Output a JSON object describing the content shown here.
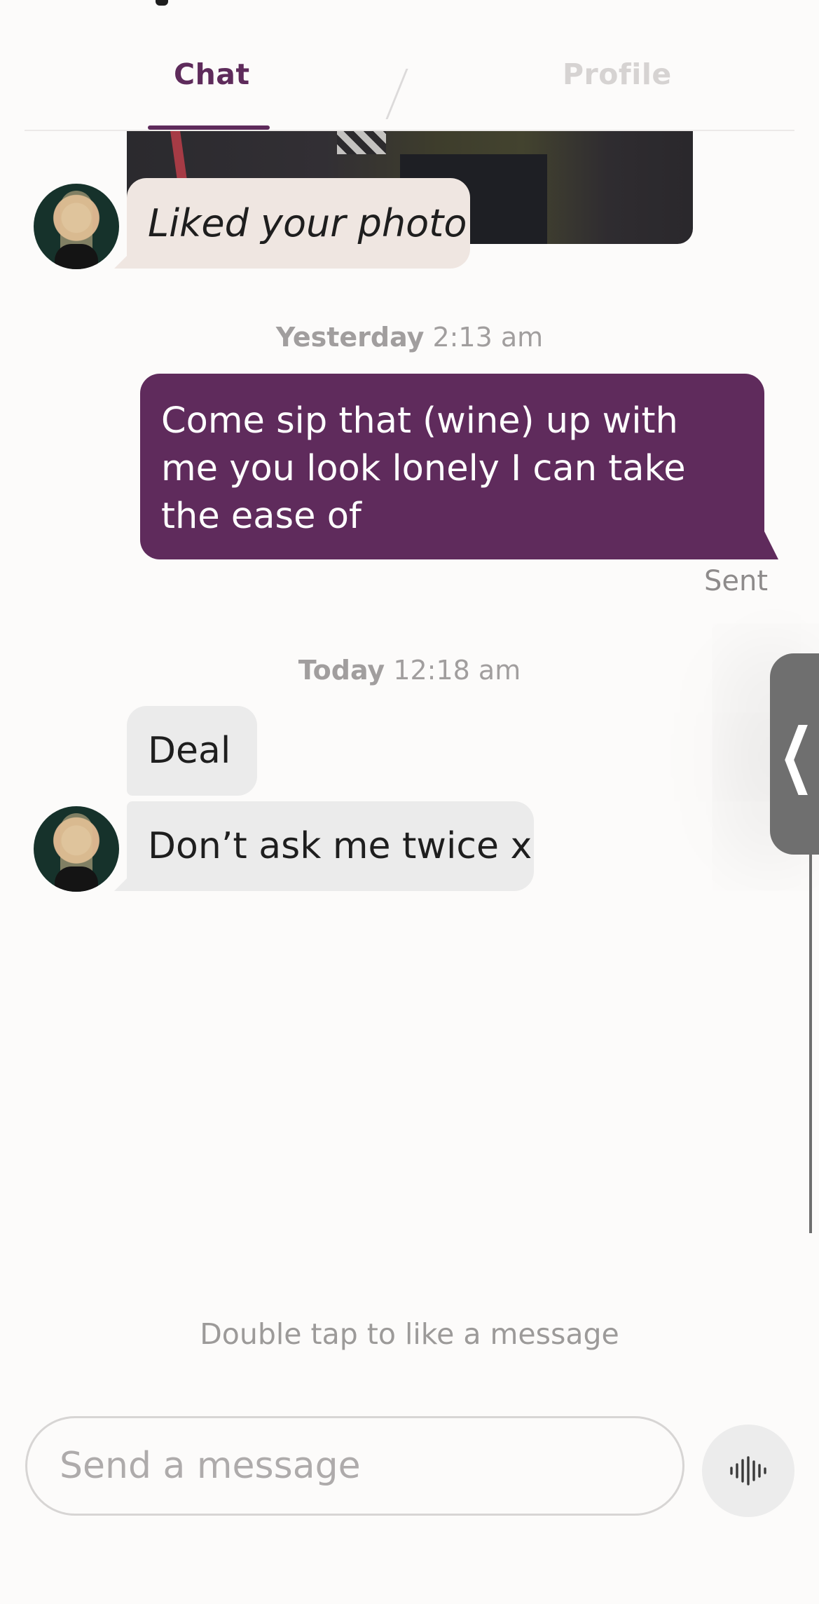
{
  "tabs": {
    "chat_label": "Chat",
    "profile_label": "Profile"
  },
  "messages": {
    "liked_text": "Liked your photo",
    "yesterday": {
      "day": "Yesterday",
      "time": "2:13 am"
    },
    "outgoing_text": "Come sip that (wine) up with me you look lonely I can take the ease of",
    "sent_status": "Sent",
    "today": {
      "day": "Today",
      "time": "12:18 am"
    },
    "incoming_1": "Deal",
    "incoming_2": "Don’t ask me twice x"
  },
  "side_handle": {
    "glyph": "❮"
  },
  "hint": "Double tap to like a message",
  "composer": {
    "placeholder": "Send a message",
    "value": ""
  },
  "icons": {
    "voice": "waveform-icon",
    "side": "chevron-left-icon"
  },
  "colors": {
    "accent": "#5f2b5c",
    "incoming_bubble": "#ebebeb",
    "liked_bubble": "#efe6e1"
  }
}
